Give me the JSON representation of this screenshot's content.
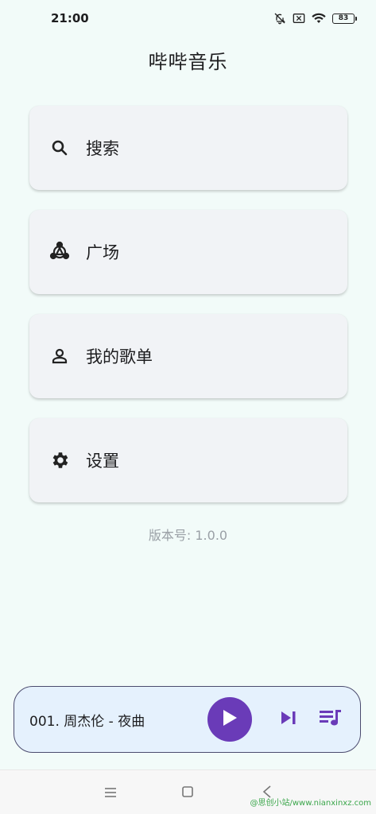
{
  "status_bar": {
    "time": "21:00",
    "battery": "83",
    "icons": [
      "bell-off-icon",
      "sim-x-icon",
      "wifi-icon",
      "battery-icon"
    ]
  },
  "app": {
    "title": "哔哔音乐"
  },
  "menu": {
    "items": [
      {
        "label": "搜索",
        "icon": "search-icon"
      },
      {
        "label": "广场",
        "icon": "community-icon"
      },
      {
        "label": "我的歌单",
        "icon": "person-icon"
      },
      {
        "label": "设置",
        "icon": "gear-icon"
      }
    ]
  },
  "version": "版本号: 1.0.0",
  "player": {
    "track": "001. 周杰伦 - 夜曲",
    "accent_color": "#6a3bb8",
    "background_color": "#e5f1fd"
  },
  "nav": {
    "watermark": "@思创小站/www.nianxinxz.com"
  }
}
